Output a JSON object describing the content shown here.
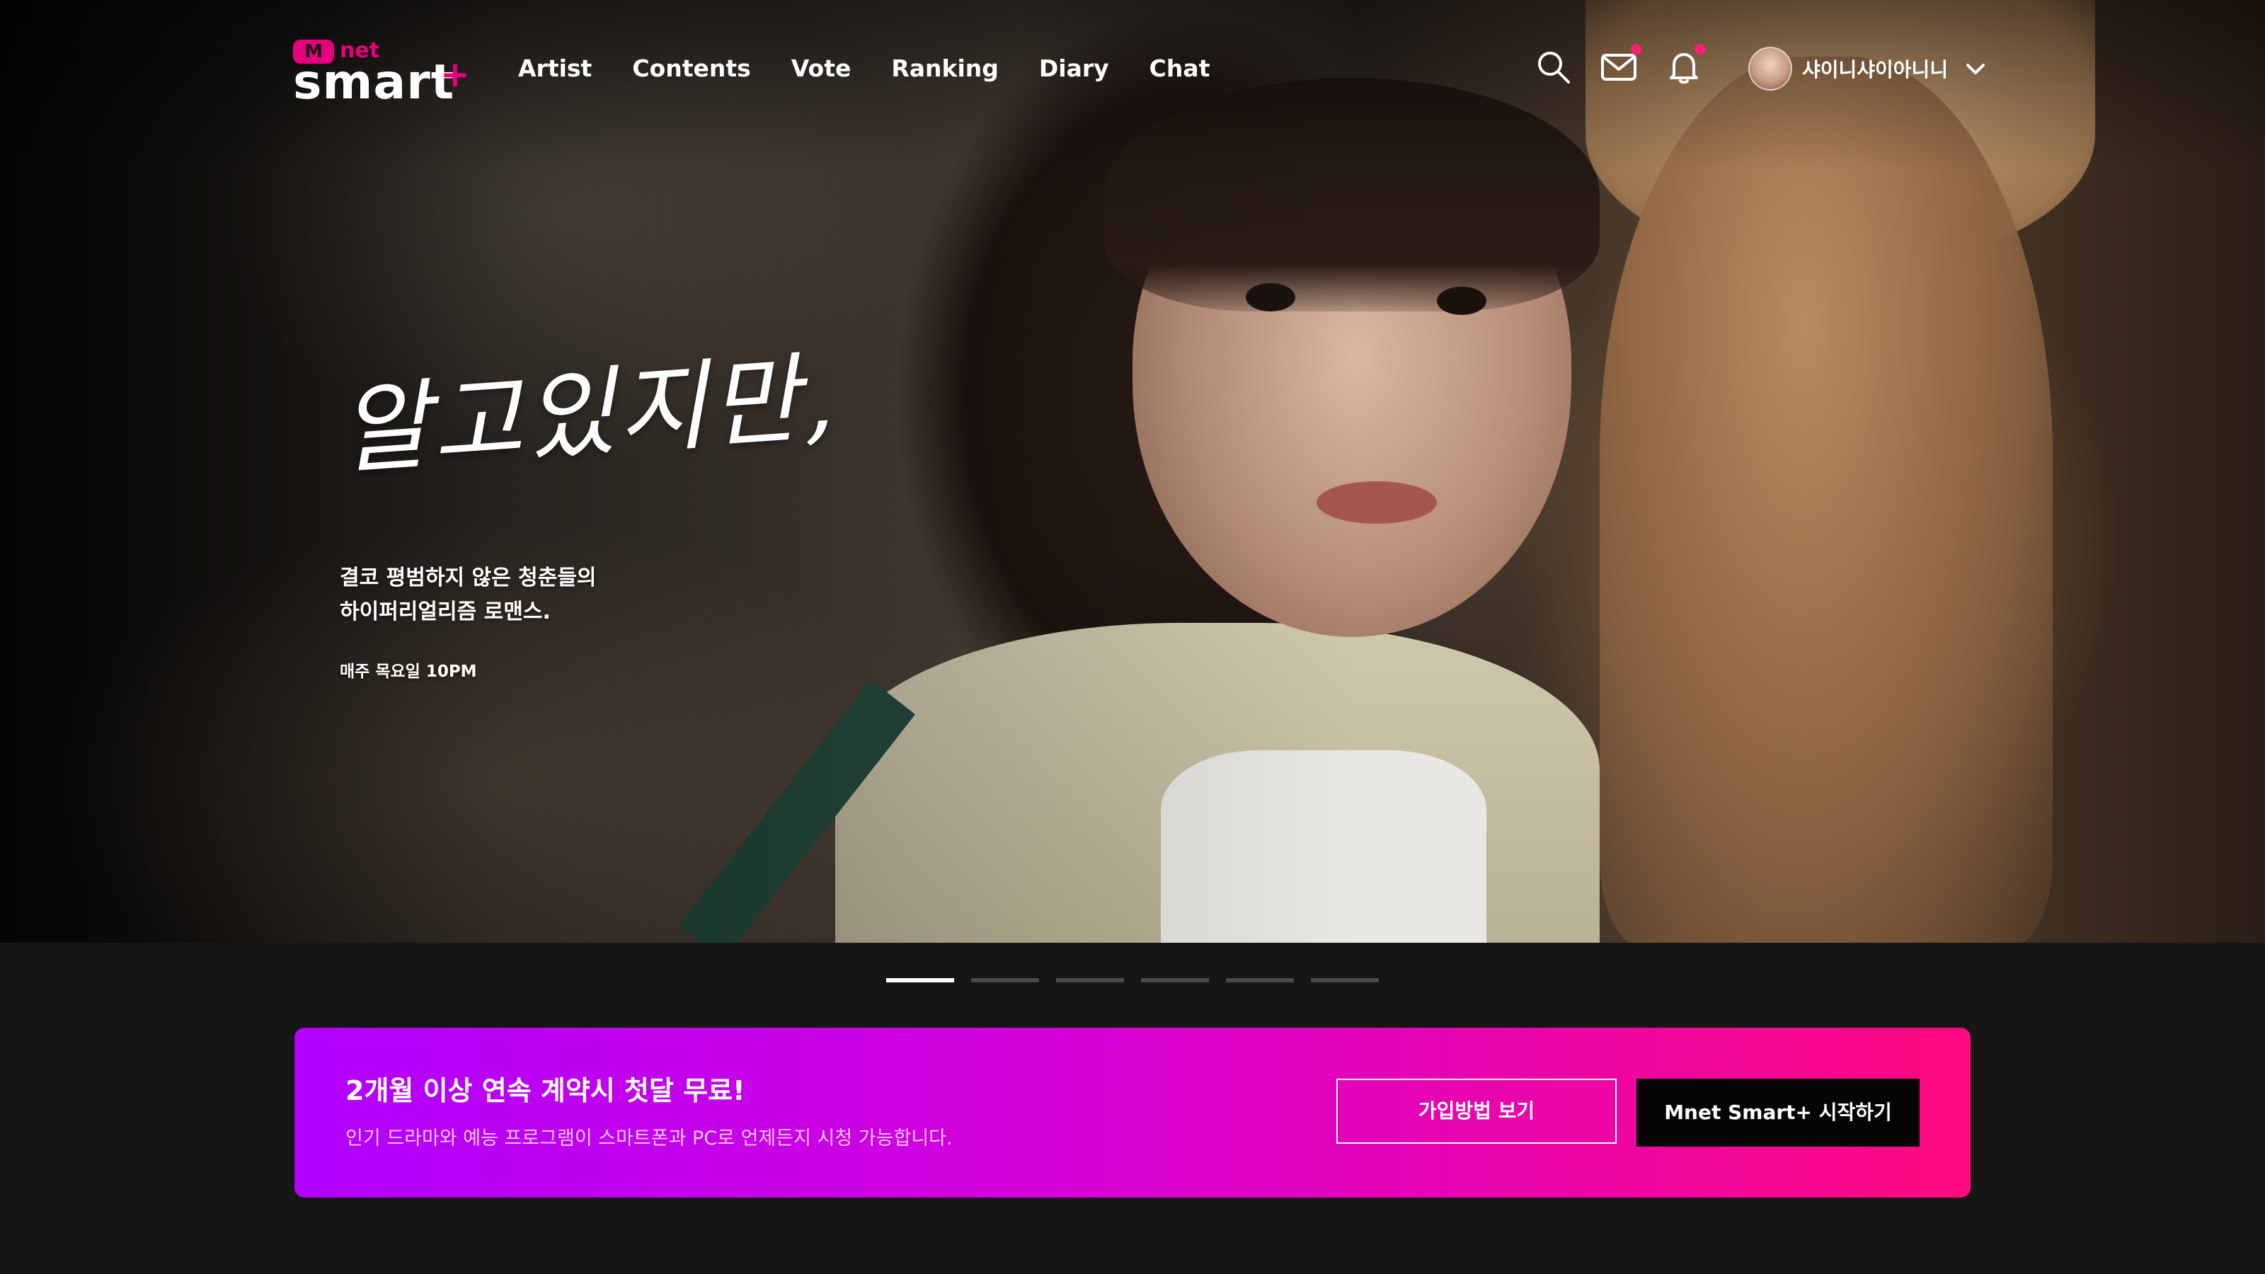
{
  "brand": {
    "logo_m": "M",
    "logo_net": "net",
    "logo_word": "smart",
    "logo_plus": "+"
  },
  "nav": {
    "items": [
      {
        "label": "Artist"
      },
      {
        "label": "Contents"
      },
      {
        "label": "Vote"
      },
      {
        "label": "Ranking"
      },
      {
        "label": "Diary"
      },
      {
        "label": "Chat"
      }
    ]
  },
  "header": {
    "icons": [
      "search-icon",
      "mail-icon",
      "bell-icon"
    ],
    "user_name": "샤이니샤이아니니"
  },
  "hero": {
    "title": "알고있지만,",
    "description_line1": "결코 평범하지 않은 청춘들의",
    "description_line2": "하이퍼리얼리즘 로맨스.",
    "schedule": "매주 목요일 10PM",
    "slides_total": 6,
    "active_slide": 1
  },
  "promo": {
    "title": "2개월 이상 연속 계약시 첫달 무료!",
    "subtitle": "인기 드라마와 예능 프로그램이 스마트폰과 PC로 언제든지 시청 가능합니다.",
    "secondary_button": "가입방법 보기",
    "primary_button": "Mnet Smart+ 시작하기"
  },
  "colors": {
    "accent": "#e6007e",
    "notification_dot": "#ff1f74",
    "promo_gradient_start": "#b100ff",
    "promo_gradient_end": "#ff0a80",
    "page_background": "#161616"
  }
}
